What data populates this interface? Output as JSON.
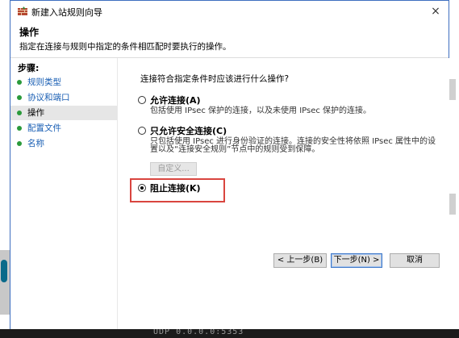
{
  "window": {
    "title": "新建入站规则向导",
    "close_symbol": "×"
  },
  "header": {
    "title": "操作",
    "description": "指定在连接与规则中指定的条件相匹配时要执行的操作。"
  },
  "steps": {
    "title": "步骤:",
    "items": [
      {
        "label": "规则类型"
      },
      {
        "label": "协议和端口"
      },
      {
        "label": "操作"
      },
      {
        "label": "配置文件"
      },
      {
        "label": "名称"
      }
    ]
  },
  "main": {
    "question": "连接符合指定条件时应该进行什么操作?",
    "options": [
      {
        "label": "允许连接(A)",
        "description": "包括使用 IPsec 保护的连接，以及未使用 IPsec 保护的连接。",
        "selected": false
      },
      {
        "label": "只允许安全连接(C)",
        "description_line1": "只包括使用 IPsec 进行身份验证的连接。连接的安全性将依照 IPsec 属性中的设",
        "description_line2": "置以及“连接安全规则”节点中的规则受到保障。",
        "selected": false
      },
      {
        "label": "阻止连接(K)",
        "selected": true
      }
    ],
    "customize_label": "自定义..."
  },
  "buttons": {
    "back": "< 上一步(B)",
    "next": "下一步(N) >",
    "cancel": "取消"
  },
  "background": {
    "bottom_text": "UDP    0.0.0.0:5353"
  },
  "colors": {
    "highlight": "#d9453f",
    "link": "#1a5fb4",
    "step_dot": "#2a9a3a"
  }
}
